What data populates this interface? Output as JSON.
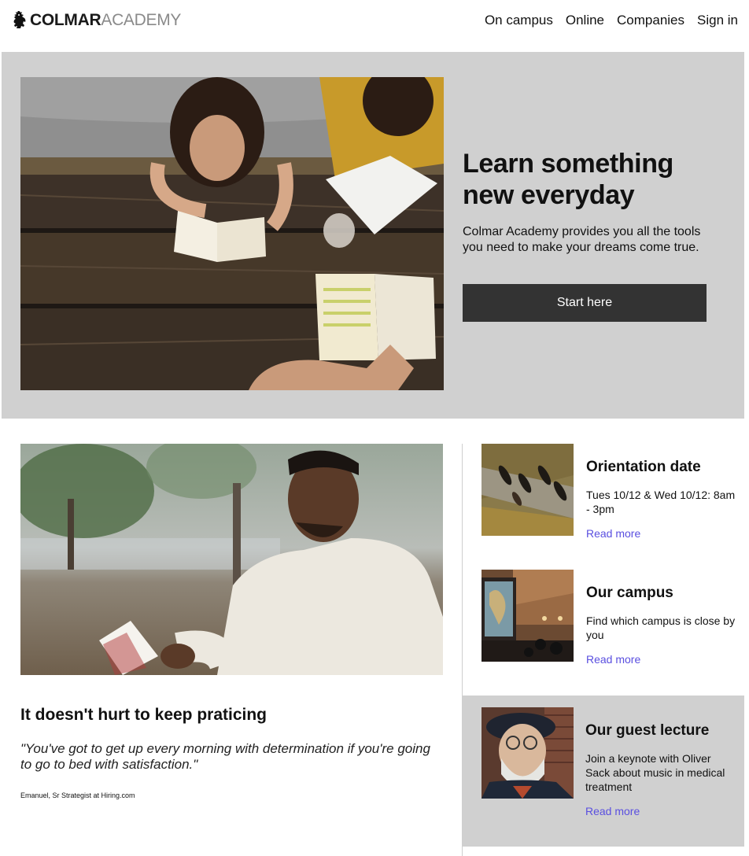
{
  "nav": {
    "brand_bold": "COLMAR",
    "brand_light": "ACADEMY",
    "links": [
      "On campus",
      "Online",
      "Companies",
      "Sign in"
    ]
  },
  "hero": {
    "title": "Learn something new everyday",
    "text": "Colmar Academy provides you all the tools you need to make your dreams come true.",
    "button_label": "Start here",
    "background": "#d0d0d0",
    "button_color": "#333333"
  },
  "article": {
    "title": "It doesn't hurt to keep praticing",
    "quote": "\"You've got to get up every morning with determination if you're going to go to bed with satisfaction.\"",
    "credit": "Emanuel, Sr Strategist at Hiring.com"
  },
  "cards": [
    {
      "title": "Orientation date",
      "text": "Tues 10/12 & Wed 10/12: 8am - 3pm",
      "link": "Read more"
    },
    {
      "title": "Our campus",
      "text": "Find which campus is close by you",
      "link": "Read more"
    },
    {
      "title": "Our guest lecture",
      "text": "Join a keynote with Oliver Sack about music in medical treatment",
      "link": "Read more"
    }
  ],
  "colors": {
    "link": "#5a4fe0",
    "section_gray": "#d0d0d0"
  },
  "icons": {
    "brand": "griffin-logo-icon"
  }
}
